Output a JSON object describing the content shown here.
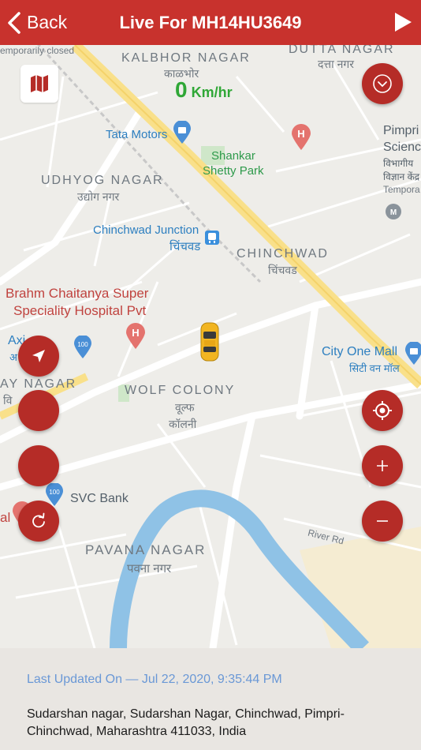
{
  "header": {
    "back_label": "Back",
    "title": "Live For MH14HU3649"
  },
  "map": {
    "speed_value": "0",
    "speed_unit": "Km/hr",
    "labels": {
      "temp_closed": "emporarily closed",
      "kalbhor_en": "KALBHOR NAGAR",
      "kalbhor_dev": "काळभोर",
      "dutta_en": "DUTTA NAGAR",
      "dutta_dev": "दत्ता नगर",
      "tata_motors": "Tata Motors",
      "shankar": "Shankar",
      "shetty_park": "Shetty Park",
      "pimpri": "Pimpri",
      "science": "Science",
      "vibhagiya": "विभागीय",
      "vigyan": "विज्ञान केंद्र",
      "tempora": "Tempora",
      "udhyog_en": "UDHYOG NAGAR",
      "udhyog_dev": "उद्योग नगर",
      "chinchwad_junction": "Chinchwad Junction",
      "chinchwad_junction_dev": "चिंचवड",
      "chinchwad_en": "CHINCHWAD",
      "chinchwad_dev": "चिंचवड",
      "brahm_1": "Brahm Chaitanya Super",
      "brahm_2": "Speciality Hospital Pvt",
      "axis": "Axi",
      "axis_dev": "अ",
      "jay_nagar": "AY NAGAR",
      "jay_dev": "वि",
      "wolf_en": "WOLF COLONY",
      "wolf_dev_1": "वूल्फ",
      "wolf_dev_2": "कॉलनी",
      "city_one": "City One Mall",
      "city_one_dev": "सिटी वन मॉल",
      "svc_bank": "SVC Bank",
      "al": "al",
      "river_rd": "River Rd",
      "pavana_en": "PAVANA NAGAR",
      "pavana_dev": "पवना नगर"
    }
  },
  "icons": {
    "map": "map-icon",
    "expand": "chevron-down-circle-icon",
    "navigate": "navigation-arrow-icon",
    "refresh": "refresh-icon",
    "locate": "target-icon",
    "zoom_in": "plus-icon",
    "zoom_out": "minus-icon"
  },
  "footer": {
    "last_updated": "Last Updated On — Jul 22, 2020, 9:35:44 PM",
    "address": "Sudarshan nagar, Sudarshan Nagar, Chinchwad, Pimpri-Chinchwad, Maharashtra 411033, India"
  },
  "colors": {
    "header": "#c8322d",
    "fab": "#b52c27",
    "speed": "#2fa736",
    "updated_text": "#6a98d6",
    "river": "#8fc2e6"
  }
}
